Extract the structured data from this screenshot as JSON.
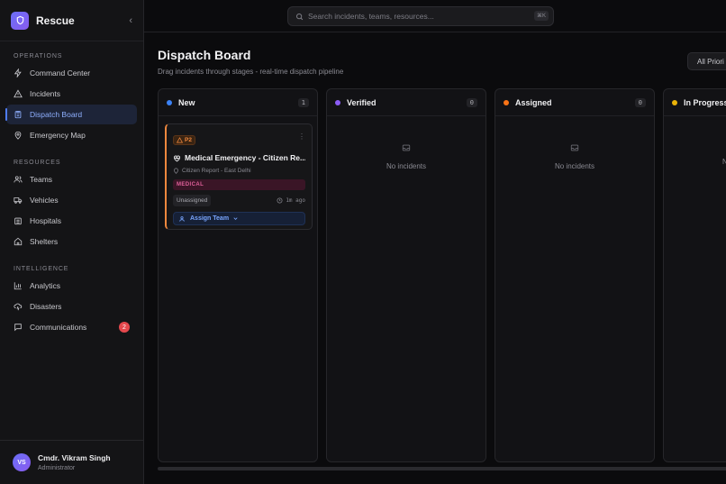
{
  "app": {
    "name": "Rescue"
  },
  "sidebar": {
    "sections": [
      {
        "label": "OPERATIONS",
        "items": [
          "Command Center",
          "Incidents",
          "Dispatch Board",
          "Emergency Map"
        ]
      },
      {
        "label": "RESOURCES",
        "items": [
          "Teams",
          "Vehicles",
          "Hospitals",
          "Shelters"
        ]
      },
      {
        "label": "INTELLIGENCE",
        "items": [
          "Analytics",
          "Disasters",
          "Communications"
        ]
      }
    ],
    "active_item": "Dispatch Board",
    "communications_badge": "2"
  },
  "user": {
    "initials": "VS",
    "name": "Cmdr. Vikram Singh",
    "role": "Administrator"
  },
  "search": {
    "placeholder": "Search incidents, teams, resources...",
    "shortcut": "⌘K"
  },
  "page": {
    "title": "Dispatch Board",
    "subtitle": "Drag incidents through stages - real-time dispatch pipeline",
    "filter_label": "All Priori"
  },
  "columns": [
    {
      "title": "New",
      "count": "1",
      "color": "#3b82f6"
    },
    {
      "title": "Verified",
      "count": "0",
      "color": "#8b5cf6",
      "empty": "No incidents"
    },
    {
      "title": "Assigned",
      "count": "0",
      "color": "#f97316",
      "empty": "No incidents"
    },
    {
      "title": "In Progress",
      "count": "",
      "color": "#eab308",
      "empty": "N"
    }
  ],
  "card": {
    "priority": "P2",
    "title": "Medical Emergency - Citizen Re...",
    "location": "Citizen Report - East Delhi",
    "category": "MEDICAL",
    "status": "Unassigned",
    "time": "1m ago",
    "assign_label": "Assign Team"
  }
}
